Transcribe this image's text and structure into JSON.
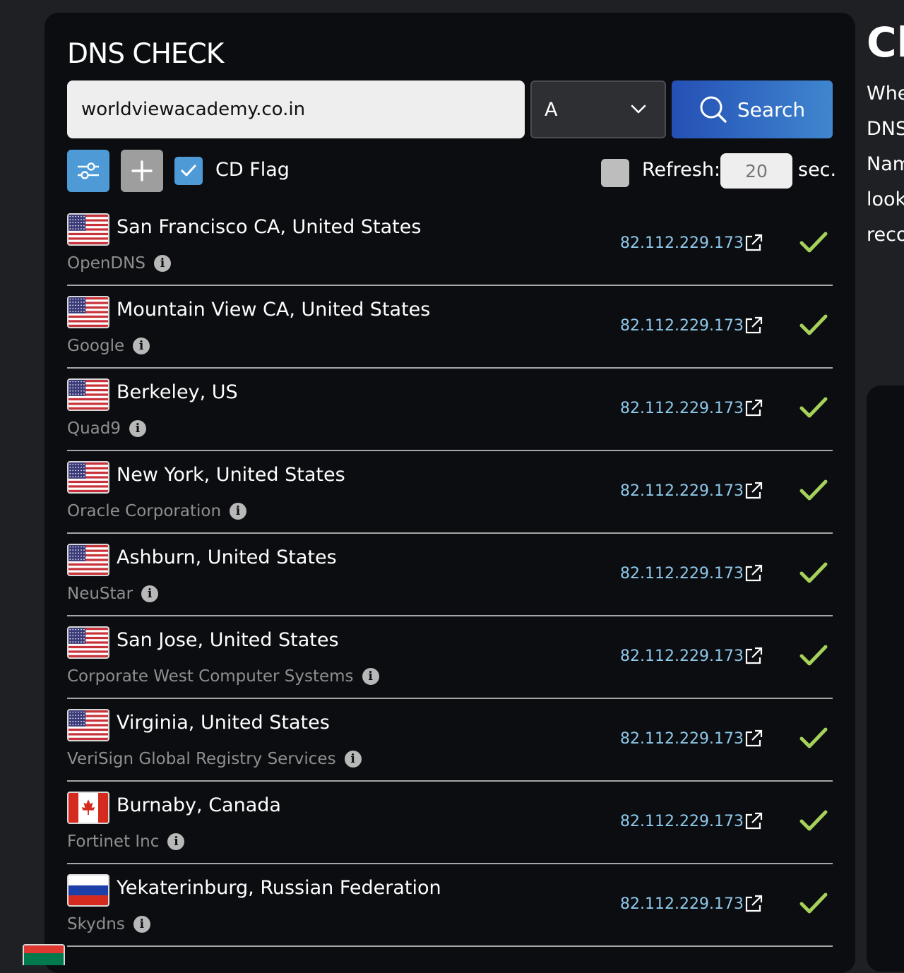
{
  "page_title": "DNS CHECK",
  "search": {
    "domain_value": "worldviewacademy.co.in",
    "record_type": "A",
    "search_label": "Search"
  },
  "options": {
    "cd_flag_label": "CD Flag",
    "cd_flag_checked": true,
    "refresh_checked": false,
    "refresh_label": "Refresh:",
    "refresh_placeholder": "20",
    "refresh_unit": "sec."
  },
  "results": [
    {
      "flag": "us-flag",
      "location": "San Francisco CA, United States",
      "provider": "OpenDNS",
      "ip": "82.112.229.173",
      "status": "ok"
    },
    {
      "flag": "us-flag",
      "location": "Mountain View CA, United States",
      "provider": "Google",
      "ip": "82.112.229.173",
      "status": "ok"
    },
    {
      "flag": "us-flag",
      "location": "Berkeley, US",
      "provider": "Quad9",
      "ip": "82.112.229.173",
      "status": "ok"
    },
    {
      "flag": "us-flag",
      "location": "New York, United States",
      "provider": "Oracle Corporation",
      "ip": "82.112.229.173",
      "status": "ok"
    },
    {
      "flag": "us-flag",
      "location": "Ashburn, United States",
      "provider": "NeuStar",
      "ip": "82.112.229.173",
      "status": "ok"
    },
    {
      "flag": "us-flag",
      "location": "San Jose, United States",
      "provider": "Corporate West Computer Systems",
      "ip": "82.112.229.173",
      "status": "ok"
    },
    {
      "flag": "us-flag",
      "location": "Virginia, United States",
      "provider": "VeriSign Global Registry Services",
      "ip": "82.112.229.173",
      "status": "ok"
    },
    {
      "flag": "ca-flag",
      "location": "Burnaby, Canada",
      "provider": "Fortinet Inc",
      "ip": "82.112.229.173",
      "status": "ok"
    },
    {
      "flag": "ru-flag",
      "location": "Yekaterinburg, Russian Federation",
      "provider": "Skydns",
      "ip": "82.112.229.173",
      "status": "ok"
    }
  ],
  "side_panel": {
    "title": "Ch",
    "lines": [
      "Whe",
      "DNS",
      "Nam",
      "look",
      "reco"
    ]
  },
  "colors": {
    "accent_blue": "#4d9ad6",
    "ip_link": "#8ec8ea",
    "check_green": "#a6d15a",
    "panel_bg": "#0b0d10"
  }
}
